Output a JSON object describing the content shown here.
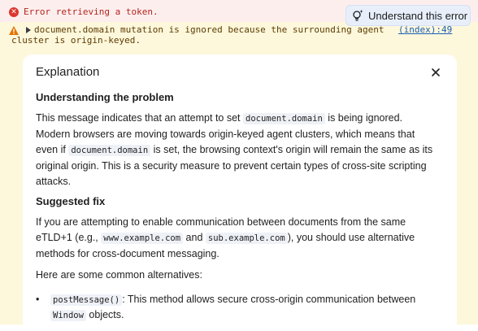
{
  "error_row": {
    "message": "Error retrieving a token.",
    "action_button": "Understand this error"
  },
  "warning_row": {
    "message_line1": "document.domain mutation is ignored because the surrounding agent",
    "message_line2": "cluster is origin-keyed.",
    "source_link": "(index):49"
  },
  "explanation": {
    "title": "Explanation",
    "section1_heading": "Understanding the problem",
    "p1": {
      "l1_a": "This message indicates that an attempt to set ",
      "l1_code": "document.domain",
      "l1_b": " is being ignored.",
      "l2": "Modern browsers are moving towards origin-keyed agent clusters, which means that",
      "l3_a": "even if ",
      "l3_code": "document.domain",
      "l3_b": " is set, the browsing context's origin will remain the same as its",
      "l4": "original origin. This is a security measure to prevent certain types of cross-site scripting",
      "l5": "attacks."
    },
    "section2_heading": "Suggested fix",
    "p2": {
      "l1": "If you are attempting to enable communication between documents from the same",
      "l2_a": "eTLD+1 (e.g., ",
      "l2_code1": "www.example.com",
      "l2_mid": " and ",
      "l2_code2": "sub.example.com",
      "l2_b": "), you should use alternative",
      "l3": "methods for cross-document messaging."
    },
    "p3": "Here are some common alternatives:",
    "bullet1": {
      "code": "postMessage()",
      "text": ": This method allows secure cross-origin communication between",
      "code2": "Window",
      "text2": " objects."
    }
  }
}
